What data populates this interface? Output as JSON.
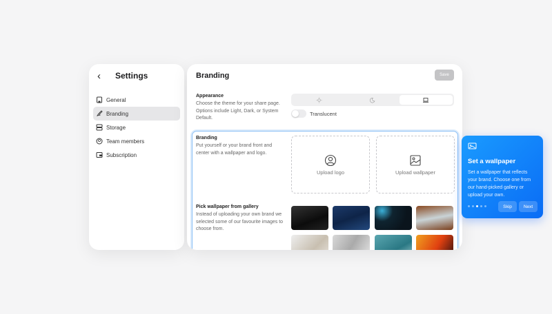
{
  "sidebar": {
    "title": "Settings",
    "items": [
      {
        "label": "General",
        "icon": "building-icon"
      },
      {
        "label": "Branding",
        "icon": "brush-icon",
        "active": true
      },
      {
        "label": "Storage",
        "icon": "storage-icon"
      },
      {
        "label": "Team members",
        "icon": "user-circle-icon"
      },
      {
        "label": "Subscription",
        "icon": "wallet-icon"
      }
    ]
  },
  "main": {
    "title": "Branding",
    "save_label": "Save",
    "appearance": {
      "title": "Appearance",
      "description": "Choose the theme for your share page. Options include Light, Dark, or System Default.",
      "options": [
        "light",
        "dark",
        "system"
      ],
      "selected": "system",
      "translucent_label": "Translucent",
      "translucent": false
    },
    "branding": {
      "title": "Branding",
      "description": "Put yourself or your brand front and center with a wallpaper and logo.",
      "upload_logo": "Upload logo",
      "upload_wallpaper": "Upload wallpaper"
    },
    "gallery": {
      "title": "Pick wallpaper from gallery",
      "description": "Instead of uploading your own brand we selected some of our favourite images to choose from."
    }
  },
  "tooltip": {
    "title": "Set a wallpaper",
    "description": "Set a wallpaper that reflects your brand. Choose one from our hand-picked gallery or upload your own.",
    "step": 3,
    "total_steps": 5,
    "skip_label": "Skip",
    "next_label": "Next"
  },
  "colors": {
    "accent": "#0a84ff",
    "highlight_border": "#8cc0f5"
  }
}
